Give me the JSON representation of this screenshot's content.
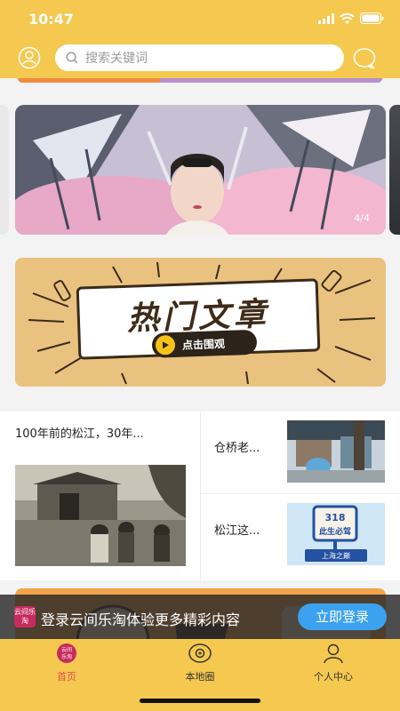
{
  "status_bar": {
    "time": "10:47"
  },
  "search": {
    "placeholder": "搜索关键词"
  },
  "carousel": {
    "pager": "4/4"
  },
  "hot": {
    "title": "热门文章",
    "cta": "点击围观"
  },
  "articles": {
    "main": {
      "title": "100年前的松江，30年..."
    },
    "side": [
      {
        "title": "仓桥老..."
      },
      {
        "title": "松江这..."
      }
    ],
    "sign_text": {
      "line1": "318",
      "line2": "此生必驾",
      "line3": "上海之巅"
    }
  },
  "login_banner": {
    "logo": "云间乐淘",
    "text": "登录云间乐淘体验更多精彩内容",
    "button": "立即登录"
  },
  "tabs": [
    {
      "label": "首页",
      "icon": "home-logo-icon",
      "active": true
    },
    {
      "label": "本地圈",
      "icon": "local-circle-icon",
      "active": false
    },
    {
      "label": "个人中心",
      "icon": "user-center-icon",
      "active": false
    }
  ],
  "colors": {
    "header": "#f5c84f",
    "active_tab": "#e05050",
    "login_button": "#3ba2f0"
  }
}
